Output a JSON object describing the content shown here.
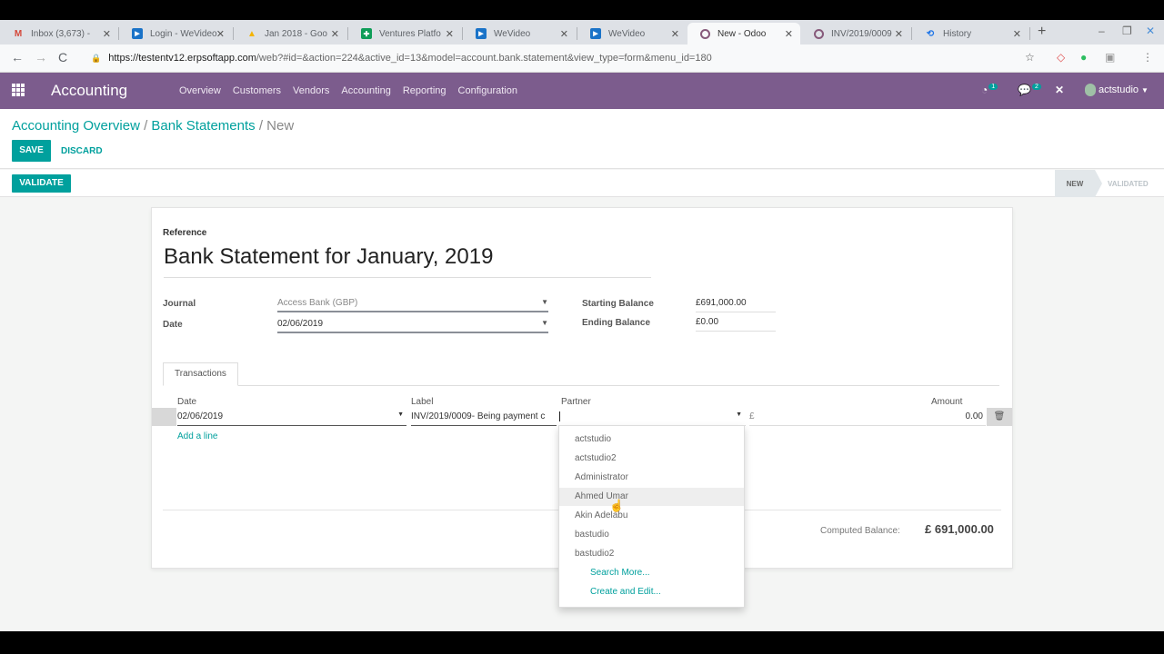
{
  "browser": {
    "tabs": [
      {
        "label": "Inbox (3,673) - ",
        "icon": "gmail-icon",
        "glyph": "M",
        "color": "#d44638"
      },
      {
        "label": "Login - WeVideo",
        "icon": "wevideo-icon",
        "glyph": "▶",
        "color": "#1a73c8"
      },
      {
        "label": "Jan 2018 - Goo",
        "icon": "drive-icon",
        "glyph": "▲",
        "color": "#f4b400"
      },
      {
        "label": "Ventures Platfo",
        "icon": "sheets-icon",
        "glyph": "✚",
        "color": "#0f9d58"
      },
      {
        "label": "WeVideo",
        "icon": "wevideo-icon",
        "glyph": "▶",
        "color": "#1a73c8"
      },
      {
        "label": "WeVideo",
        "icon": "wevideo-icon",
        "glyph": "▶",
        "color": "#1a73c8"
      },
      {
        "label": "New - Odoo",
        "icon": "odoo-icon",
        "glyph": "O",
        "color": "#875a7b",
        "active": true
      },
      {
        "label": "INV/2019/0009",
        "icon": "odoo-icon",
        "glyph": "O",
        "color": "#875a7b"
      },
      {
        "label": "History",
        "icon": "history-icon",
        "glyph": "⟲",
        "color": "#1a73e8"
      }
    ],
    "close_glyph": "✕",
    "new_tab_glyph": "+",
    "url_host": "https://testentv12.erpsoftapp.com",
    "url_path": "/web?#id=&action=224&active_id=13&model=account.bank.statement&view_type=form&menu_id=180"
  },
  "navbar": {
    "app_title": "Accounting",
    "menu": [
      "Overview",
      "Customers",
      "Vendors",
      "Accounting",
      "Reporting",
      "Configuration"
    ],
    "activity_count": "1",
    "messages_count": "2",
    "user": "actstudio"
  },
  "control_panel": {
    "breadcrumb": [
      "Accounting Overview",
      "Bank Statements",
      "New"
    ],
    "save_label": "SAVE",
    "discard_label": "DISCARD",
    "validate_label": "VALIDATE",
    "stages": [
      "NEW",
      "VALIDATED"
    ],
    "active_stage": "NEW"
  },
  "form": {
    "reference_label": "Reference",
    "reference_value": "Bank Statement for January, 2019",
    "journal_label": "Journal",
    "journal_value": "Access Bank (GBP)",
    "date_label": "Date",
    "date_value": "02/06/2019",
    "starting_balance_label": "Starting Balance",
    "starting_balance_value": "£691,000.00",
    "ending_balance_label": "Ending Balance",
    "ending_balance_value": "£0.00",
    "tab_transactions": "Transactions",
    "columns": {
      "date": "Date",
      "label": "Label",
      "partner": "Partner",
      "amount": "Amount"
    },
    "line": {
      "date": "02/06/2019",
      "label": "INV/2019/0009- Being payment c",
      "partner": "",
      "currency": "£",
      "amount": "0.00"
    },
    "add_line": "Add a line",
    "computed_balance_label": "Computed Balance:",
    "computed_balance_value": "£ 691,000.00"
  },
  "partner_dropdown": {
    "items": [
      "actstudio",
      "actstudio2",
      "Administrator",
      "Ahmed Umar",
      "Akin Adelabu",
      "bastudio",
      "bastudio2"
    ],
    "hovered": "Ahmed Umar",
    "search_more": "Search More...",
    "create_edit": "Create and Edit..."
  }
}
